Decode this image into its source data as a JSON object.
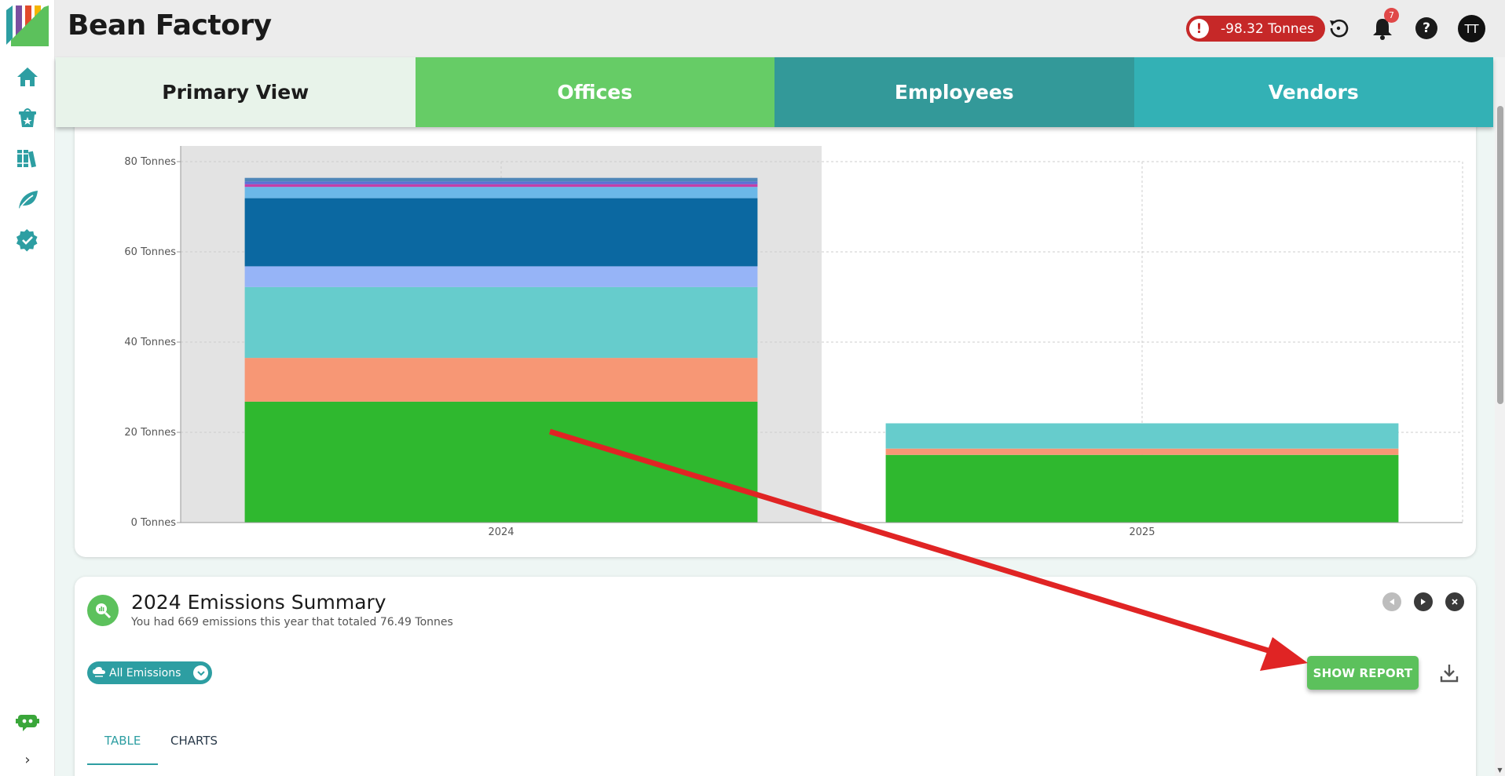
{
  "app": {
    "title": "Bean Factory"
  },
  "header": {
    "emissions_badge": "-98.32 Tonnes",
    "notification_count": "7",
    "avatar_initials": "TT",
    "help_label": "?"
  },
  "tabs": [
    {
      "label": "Primary View"
    },
    {
      "label": "Offices"
    },
    {
      "label": "Employees"
    },
    {
      "label": "Vendors"
    }
  ],
  "chart_data": {
    "type": "bar",
    "stacked": true,
    "categories": [
      "2024",
      "2025"
    ],
    "ylim": [
      0,
      80
    ],
    "yticks": [
      0,
      20,
      40,
      60,
      80
    ],
    "ytick_suffix": " Tonnes",
    "grid": true,
    "highlighted_category": "2024",
    "series": [
      {
        "color": "#2fb82f",
        "values": [
          26.8,
          15.0
        ]
      },
      {
        "color": "#f79775",
        "values": [
          9.7,
          1.4
        ]
      },
      {
        "color": "#66cccc",
        "values": [
          15.7,
          5.6
        ]
      },
      {
        "color": "#96b4f7",
        "values": [
          4.6,
          0
        ]
      },
      {
        "color": "#0b68a1",
        "values": [
          15.1,
          0
        ]
      },
      {
        "color": "#6bb8e8",
        "values": [
          2.5,
          0
        ]
      },
      {
        "color": "#c33fa8",
        "values": [
          0.6,
          0
        ]
      },
      {
        "color": "#5a6fd6",
        "values": [
          0.6,
          0
        ]
      },
      {
        "color": "#4f87b8",
        "values": [
          0.8,
          0
        ]
      }
    ]
  },
  "summary": {
    "title": "2024 Emissions Summary",
    "subtitle": "You had 669 emissions this year that totaled 76.49 Tonnes",
    "filter_label": "All Emissions",
    "show_report_label": "SHOW REPORT",
    "sub_tabs": [
      {
        "label": "TABLE"
      },
      {
        "label": "CHARTS"
      }
    ]
  },
  "annotation": {
    "color": "#e02424"
  }
}
